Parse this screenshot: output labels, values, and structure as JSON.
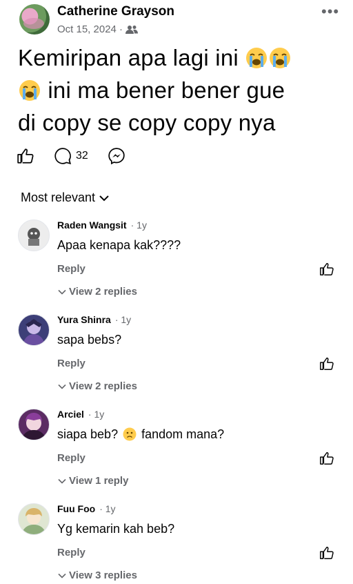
{
  "post": {
    "author": "Catherine Grayson",
    "date": "Oct 15, 2024 ·",
    "audience_icon": "friends-icon",
    "line1": "Kemiripan apa lagi ini",
    "line2": "ini ma bener bener gue",
    "line3": "di copy se copy copy nya",
    "emoji": "loudly-crying-face"
  },
  "actions": {
    "comment_count": "32"
  },
  "sort": {
    "label": "Most relevant"
  },
  "comments": [
    {
      "name": "Raden Wangsit",
      "time": "· 1y",
      "text": "Apaa kenapa kak????",
      "reply": "Reply",
      "view": "View 2 replies",
      "avatar_color": "#e9e9e9"
    },
    {
      "name": "Yura Shinra",
      "time": "· 1y",
      "text": "sapa bebs?",
      "reply": "Reply",
      "view": "View 2 replies",
      "avatar_color": "#4a4f8a"
    },
    {
      "name": "Arciel",
      "time": "· 1y",
      "text_a": "siapa beb?",
      "text_b": "fandom mana?",
      "reply": "Reply",
      "view": "View 1 reply",
      "avatar_color": "#7a3f86"
    },
    {
      "name": "Fuu Foo",
      "time": "· 1y",
      "text": "Yg kemarin kah beb?",
      "reply": "Reply",
      "view": "View 3 replies",
      "avatar_color": "#cfd7c0"
    }
  ]
}
